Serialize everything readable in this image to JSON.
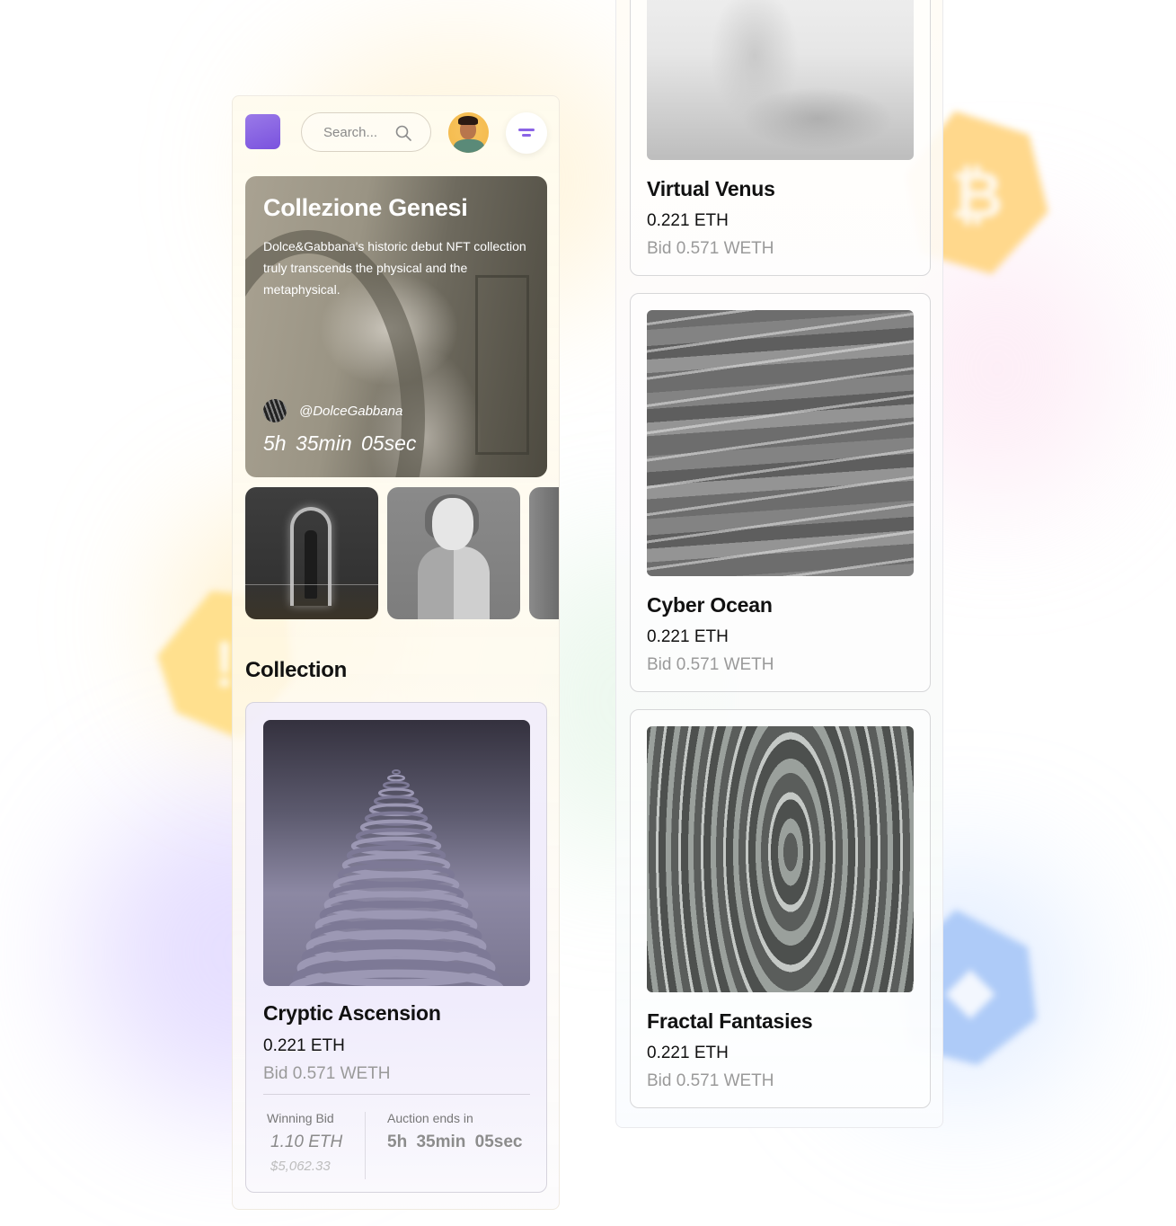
{
  "header": {
    "search_placeholder": "Search...",
    "search_icon": "search-icon",
    "filter_icon": "filter-icon",
    "avatar_label": "user-avatar"
  },
  "hero": {
    "title": "Collezione Genesi",
    "description": "Dolce&Gabbana's historic debut NFT collection truly transcends the physical and the metaphysical.",
    "creator_handle": "@DolceGabbana",
    "timer": "5h  35min  05sec"
  },
  "thumbnails": [
    {
      "name": "portal-figure"
    },
    {
      "name": "3d-character"
    },
    {
      "name": "abstract-silver"
    }
  ],
  "collection": {
    "section_title": "Collection",
    "featured": {
      "title": "Cryptic Ascension",
      "price": "0.221 ETH",
      "bid": "Bid 0.571 WETH",
      "winning_bid_label": "Winning Bid",
      "winning_bid_value": "1.10 ETH",
      "winning_bid_usd": "$5,062.33",
      "auction_label": "Auction ends in",
      "auction_value": "5h  35min  05sec"
    }
  },
  "gallery": [
    {
      "title": "Virtual Venus",
      "price": "0.221 ETH",
      "bid": "Bid 0.571 WETH"
    },
    {
      "title": "Cyber Ocean",
      "price": "0.221 ETH",
      "bid": "Bid 0.571 WETH"
    },
    {
      "title": "Fractal Fantasies",
      "price": "0.221 ETH",
      "bid": "Bid 0.571 WETH"
    }
  ],
  "decor": {
    "tokens": [
      "bitcoin-token-icon",
      "alert-token-icon",
      "ethereum-token-icon"
    ],
    "accent": "#7a52de",
    "token_yellow": "#ffd98f",
    "token_blue": "#a9c8f7"
  }
}
